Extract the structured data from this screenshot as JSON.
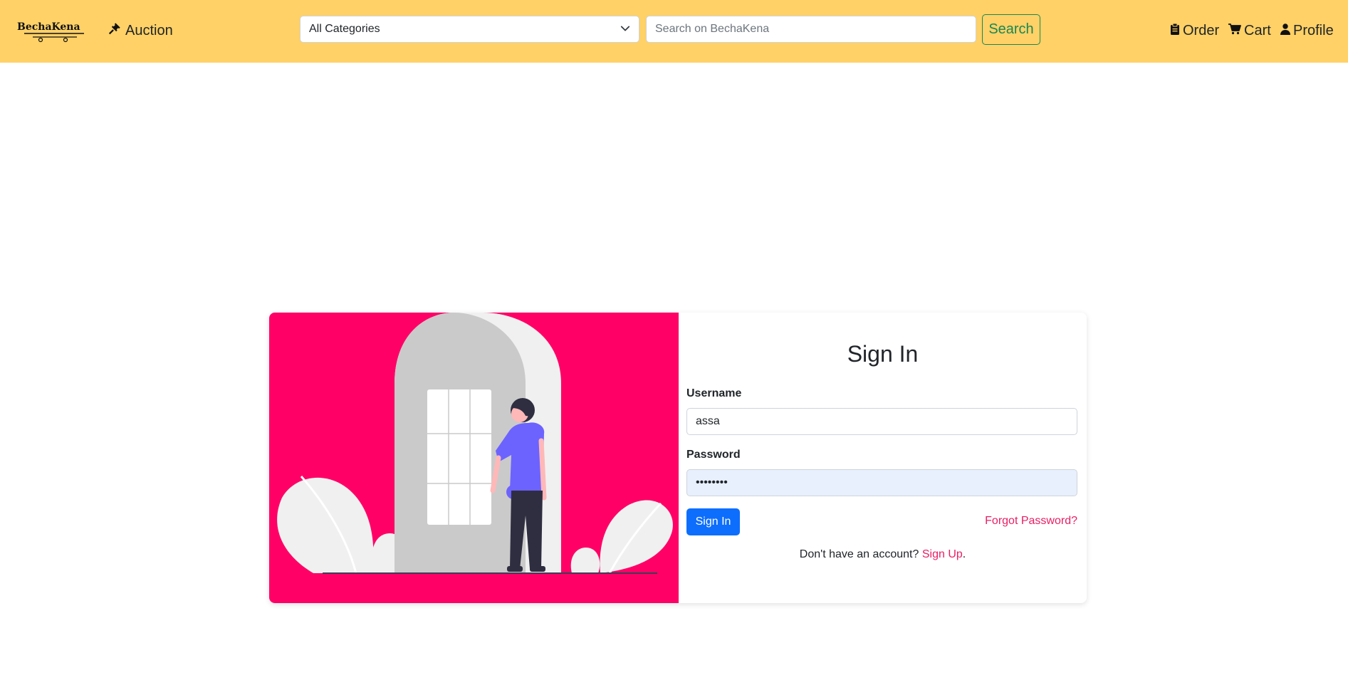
{
  "navbar": {
    "brand": "BechaKena",
    "auction_label": "Auction",
    "category_selected": "All Categories",
    "search_placeholder": "Search on BechaKena",
    "search_button": "Search",
    "order_label": "Order",
    "cart_label": "Cart",
    "profile_label": "Profile"
  },
  "signin": {
    "title": "Sign In",
    "username_label": "Username",
    "username_value": "assa",
    "password_label": "Password",
    "password_value": "assasass",
    "signin_button": "Sign In",
    "forgot_link": "Forgot Password?",
    "no_account_text": "Don't have an account? ",
    "signup_link": "Sign Up",
    "signup_suffix": "."
  },
  "colors": {
    "navbar_bg": "#ffd166",
    "illustration_bg": "#ff0066",
    "primary": "#0d6efd",
    "link": "#e91e63",
    "search_outline": "#198754"
  },
  "icons": {
    "auction": "gavel-icon",
    "category_dropdown": "chevron-down-icon",
    "order": "clipboard-icon",
    "cart": "cart-icon",
    "profile": "user-icon"
  }
}
